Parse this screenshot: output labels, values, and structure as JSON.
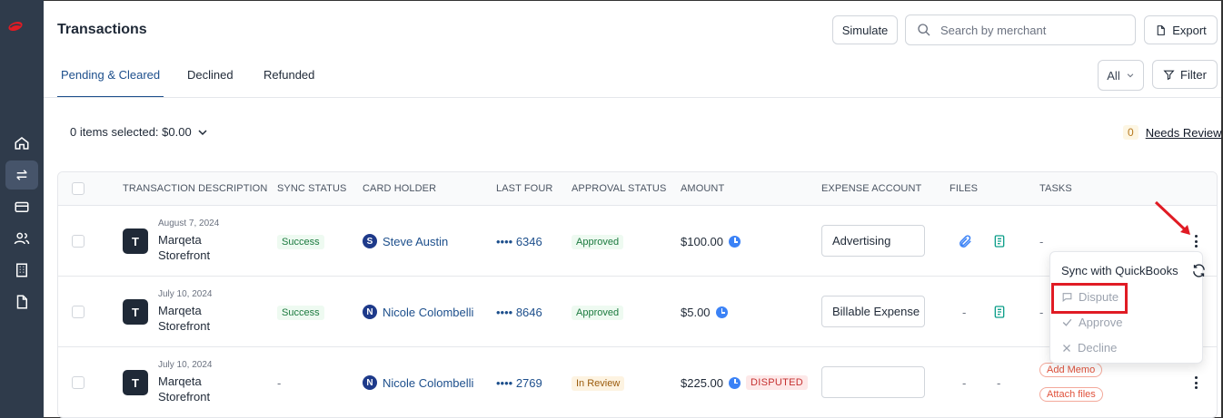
{
  "header": {
    "title": "Transactions",
    "simulate_label": "Simulate",
    "search_placeholder": "Search by merchant",
    "export_label": "Export"
  },
  "tabs": [
    {
      "label": "Pending & Cleared",
      "active": true
    },
    {
      "label": "Declined",
      "active": false
    },
    {
      "label": "Refunded",
      "active": false
    }
  ],
  "filters": {
    "all_label": "All",
    "filter_label": "Filter"
  },
  "selection": {
    "summary": "0 items selected: $0.00"
  },
  "review": {
    "count": "0",
    "label": "Needs Review"
  },
  "table": {
    "columns": [
      "TRANSACTION DESCRIPTION",
      "SYNC STATUS",
      "CARD HOLDER",
      "LAST FOUR",
      "APPROVAL STATUS",
      "AMOUNT",
      "EXPENSE ACCOUNT",
      "FILES",
      "TASKS"
    ],
    "rows": [
      {
        "avatar": "T",
        "date": "August 7, 2024",
        "merchant_line1": "Marqeta",
        "merchant_line2": "Storefront",
        "sync_status": "Success",
        "holder_initial": "S",
        "holder": "Steve Austin",
        "last_four": "•••• 6346",
        "approval_status": "Approved",
        "amount": "$100.00",
        "expense_account": "Advertising",
        "tasks": "-"
      },
      {
        "avatar": "T",
        "date": "July 10, 2024",
        "merchant_line1": "Marqeta",
        "merchant_line2": "Storefront",
        "sync_status": "Success",
        "holder_initial": "N",
        "holder": "Nicole Colombelli",
        "last_four": "•••• 8646",
        "approval_status": "Approved",
        "amount": "$5.00",
        "expense_account": "Billable Expense",
        "files_dash": "-",
        "tasks": "-"
      },
      {
        "avatar": "T",
        "date": "July 10, 2024",
        "merchant_line1": "Marqeta",
        "merchant_line2": "Storefront",
        "sync_status": "-",
        "holder_initial": "N",
        "holder": "Nicole Colombelli",
        "last_four": "•••• 2769",
        "approval_status": "In Review",
        "amount": "$225.00",
        "disputed": "DISPUTED",
        "expense_account": "",
        "files_dash1": "-",
        "files_dash2": "-",
        "task_chips": [
          "Add Memo",
          "Attach files"
        ]
      }
    ]
  },
  "row_menu": {
    "items": [
      {
        "label": "Sync with QuickBooks",
        "disabled": false
      },
      {
        "label": "Dispute",
        "disabled": true
      },
      {
        "label": "Approve",
        "disabled": true
      },
      {
        "label": "Decline",
        "disabled": true
      }
    ]
  },
  "colors": {
    "sidebar": "#2f3b4b",
    "accent": "#1d4f8c",
    "logo_red": "#e01b24",
    "highlight_red": "#e01b24"
  }
}
